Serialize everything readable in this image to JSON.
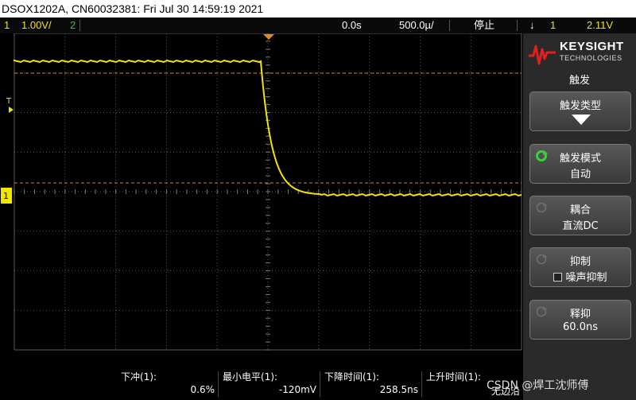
{
  "title": "DSOX1202A, CN60032381: Fri Jul 30 14:59:19 2021",
  "status": {
    "ch1_num": "1",
    "ch1_scale": "1.00V/",
    "ch2_num": "2",
    "time_ref": "0.0s",
    "time_scale": "500.0µ/",
    "run_state": "停止",
    "trig_slope": "↓",
    "trig_ch": "1",
    "trig_level": "2.11V"
  },
  "scope": {
    "trigger_marker": "T",
    "ground_marker": "1"
  },
  "panel": {
    "logo_line1": "KEYSIGHT",
    "logo_line2": "TECHNOLOGIES",
    "title": "触发",
    "buttons": [
      {
        "line1": "触发类型",
        "line2": ""
      },
      {
        "line1": "触发模式",
        "line2": "自动"
      },
      {
        "line1": "耦合",
        "line2": "直流DC"
      },
      {
        "line1": "抑制",
        "line2": "噪声抑制"
      },
      {
        "line1": "释抑",
        "line2": "60.0ns"
      }
    ]
  },
  "measurements": [
    {
      "label": "下冲(1):",
      "value": "0.6%"
    },
    {
      "label": "最小电平(1):",
      "value": "-120mV"
    },
    {
      "label": "下降时间(1):",
      "value": "258.5ns"
    },
    {
      "label": "上升时间(1):",
      "value": "无边沿"
    }
  ],
  "watermark": "CSDN @焊工沈师傅",
  "colors": {
    "ch1": "#f2e500",
    "ch2": "#22d022",
    "cursor": "#d4803a",
    "grid": "#5a5a5a"
  }
}
